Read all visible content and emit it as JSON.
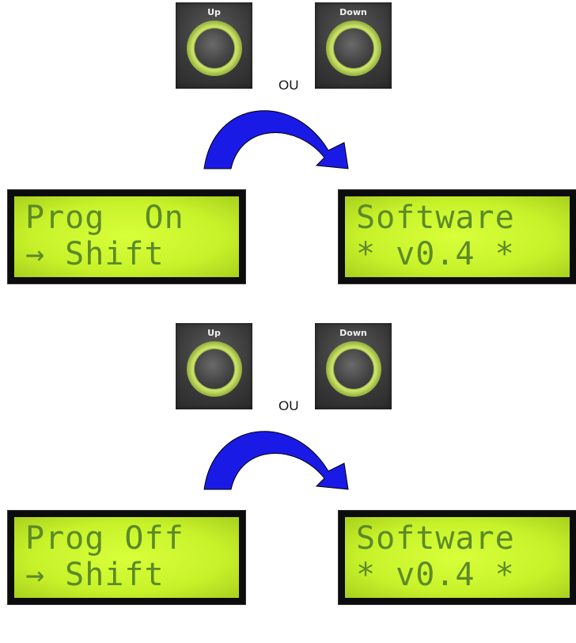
{
  "buttons": {
    "up_label": "Up",
    "down_label": "Down"
  },
  "separator": "OU",
  "colors": {
    "arrow": "#1a1ae6",
    "lcd_background": "#c9f22e",
    "lcd_text": "#5c8a28",
    "button_ring": "#cfe86a"
  },
  "icons": {
    "arrow": "curved-arrow-icon"
  },
  "sequences": [
    {
      "from_lcd": {
        "line1": "Prog  On",
        "line2": "→ Shift"
      },
      "to_lcd": {
        "line1": "Software",
        "line2": "* v0.4 *"
      }
    },
    {
      "from_lcd": {
        "line1": "Prog Off",
        "line2": "→ Shift"
      },
      "to_lcd": {
        "line1": "Software",
        "line2": "* v0.4 *"
      }
    }
  ]
}
